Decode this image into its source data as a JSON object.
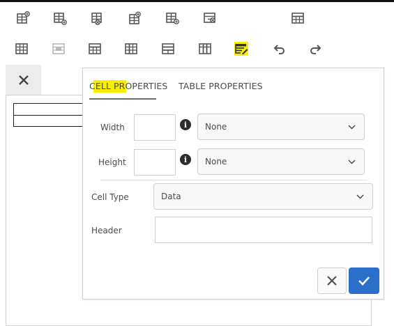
{
  "toolbar": {
    "row1": [
      {
        "icon": "insert-row-above-icon"
      },
      {
        "icon": "insert-row-below-icon"
      },
      {
        "icon": "delete-row-icon"
      },
      {
        "icon": "insert-column-before-icon"
      },
      {
        "icon": "insert-column-after-icon"
      },
      {
        "icon": "delete-column-icon"
      },
      {
        "icon": "table-icon"
      }
    ],
    "row2": [
      {
        "icon": "merge-cells-icon"
      },
      {
        "icon": "split-cell-icon"
      },
      {
        "icon": "table-header-row-icon"
      },
      {
        "icon": "table-header-column-icon"
      },
      {
        "icon": "table-rows-icon"
      },
      {
        "icon": "table-columns-icon"
      },
      {
        "icon": "table-properties-icon",
        "selected": true,
        "highlight_color": "#f6f000"
      },
      {
        "icon": "undo-icon"
      },
      {
        "icon": "redo-icon"
      }
    ]
  },
  "dialog": {
    "tabs": [
      {
        "label": "CELL PROPERTIES",
        "active": true
      },
      {
        "label": "TABLE PROPERTIES",
        "active": false
      }
    ],
    "width": {
      "label": "Width",
      "value": "",
      "unit_selected": "None"
    },
    "height": {
      "label": "Height",
      "value": "",
      "unit_selected": "None"
    },
    "cell_type": {
      "label": "Cell Type",
      "selected": "Data"
    },
    "header": {
      "label": "Header",
      "value": ""
    },
    "info_glyph": "i"
  },
  "colors": {
    "accent": "#2a6fc9",
    "highlight": "#f6f000"
  }
}
